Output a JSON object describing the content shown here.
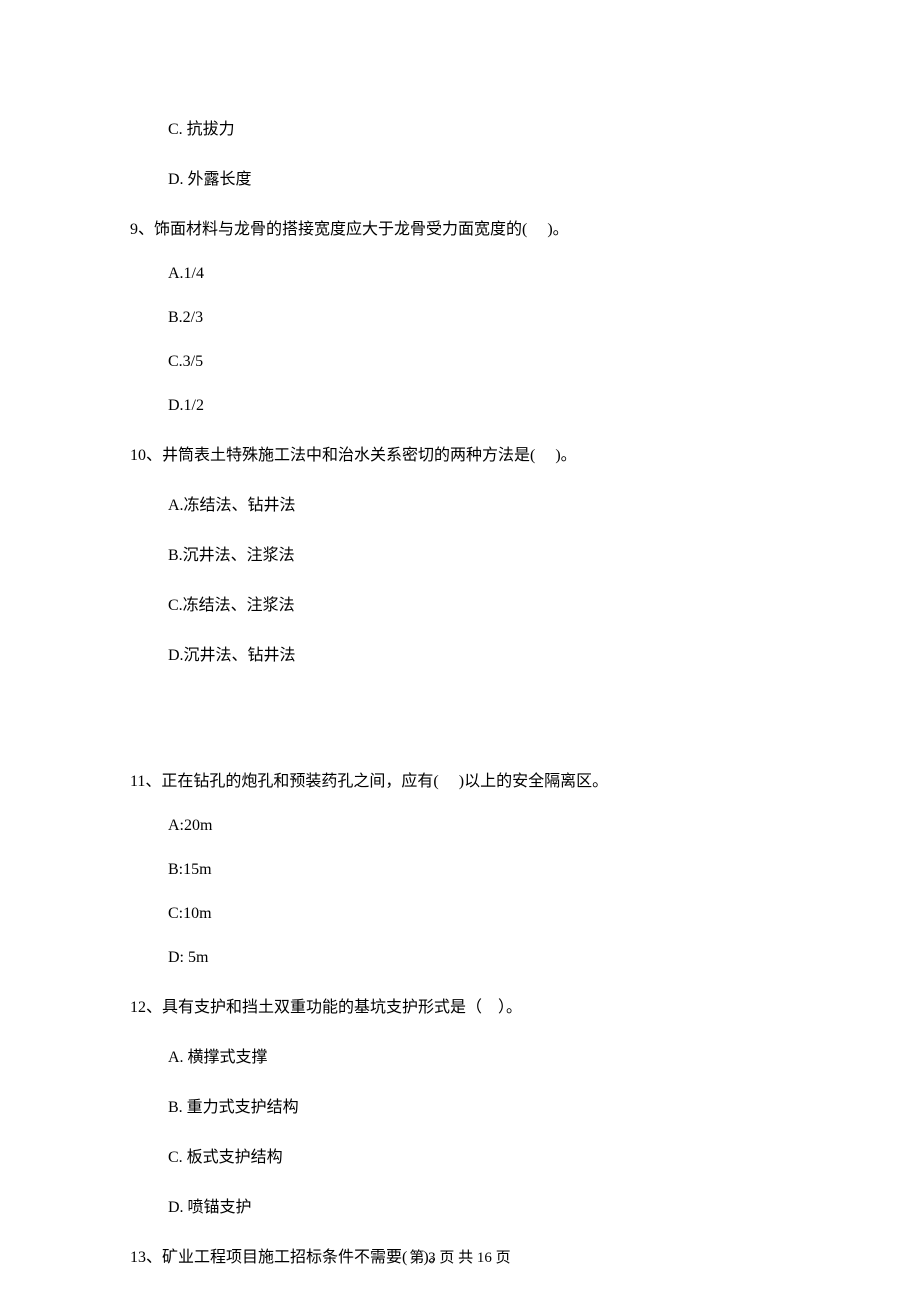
{
  "preOptions": [
    "C. 抗拔力",
    "D. 外露长度"
  ],
  "questions": [
    {
      "stem": "9、饰面材料与龙骨的搭接宽度应大于龙骨受力面宽度的(     )。",
      "options": [
        "A.1/4",
        "B.2/3",
        "C.3/5",
        "D.1/2"
      ]
    },
    {
      "stem": "10、井筒表土特殊施工法中和治水关系密切的两种方法是(     )。",
      "options": [
        "A.冻结法、钻井法",
        "B.沉井法、注浆法",
        "C.冻结法、注浆法",
        "D.沉井法、钻井法"
      ]
    },
    {
      "stem": "11、正在钻孔的炮孔和预装药孔之间，应有(     )以上的安全隔离区。",
      "options": [
        "A:20m",
        "B:15m",
        "C:10m",
        "D: 5m"
      ]
    },
    {
      "stem": "12、具有支护和挡土双重功能的基坑支护形式是（    ）。",
      "options": [
        "A. 横撑式支撑",
        "B. 重力式支护结构",
        "C. 板式支护结构",
        "D. 喷锚支护"
      ]
    },
    {
      "stem": "13、矿业工程项目施工招标条件不需要(    )。",
      "options": []
    }
  ],
  "gapAfterQuestionIndex": 1,
  "footer": "第 3 页 共 16 页"
}
